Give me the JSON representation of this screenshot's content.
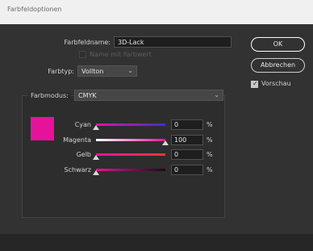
{
  "window": {
    "title": "Farbfeldoptionen"
  },
  "form": {
    "name_label": "Farbfeldname:",
    "name_value": "3D-Lack",
    "name_with_value_label": "Name mit Farbwert",
    "type_label": "Farbtyp:",
    "type_value": "Vollton",
    "mode_label": "Farbmodus:",
    "mode_value": "CMYK"
  },
  "buttons": {
    "ok": "OK",
    "cancel": "Abbrechen"
  },
  "preview": {
    "label": "Vorschau",
    "checked": true
  },
  "swatch_color": "#e6139a",
  "channels": [
    {
      "name": "Cyan",
      "value": "0",
      "unit": "%",
      "level": 0
    },
    {
      "name": "Magenta",
      "value": "100",
      "unit": "%",
      "level": 100
    },
    {
      "name": "Gelb",
      "value": "0",
      "unit": "%",
      "level": 0
    },
    {
      "name": "Schwarz",
      "value": "0",
      "unit": "%",
      "level": 0
    }
  ],
  "icons": {
    "dropdown": "chevron-down-icon",
    "checkbox": "checkmark-icon"
  }
}
